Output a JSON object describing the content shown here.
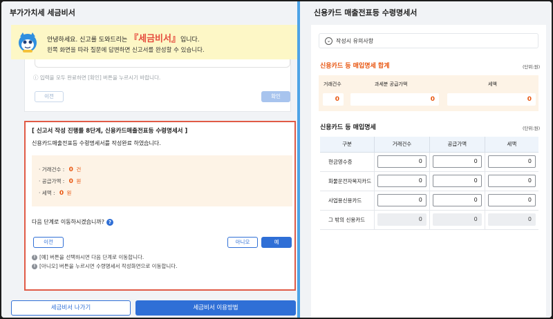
{
  "left": {
    "title": "부가가치세 세금비서",
    "banner": {
      "greeting_pre": "안녕하세요. 신고를 도와드리는",
      "brand": "『세금비서』",
      "greeting_post": "입니다.",
      "line2": "왼쪽 화면을 따라 질문에 답변하면 신고서를 완성할 수 있습니다."
    },
    "prev_step": {
      "note": "ⓘ 입력을 모두 완료하면 [확인] 버튼을 누르시기 바랍니다.",
      "back_label": "이전",
      "confirm_label": "확인"
    },
    "step": {
      "title": "[ 신고서 작성 진행률 8단계, 신용카드매출전표등 수령명세서 ]",
      "message": "신용카드매출전표등 수령명세서를 작성완료 하였습니다.",
      "summary": [
        {
          "label": "· 거래건수 :",
          "value": "0",
          "unit": "건"
        },
        {
          "label": "· 공급가액 :",
          "value": "0",
          "unit": "원"
        },
        {
          "label": "· 세액 :",
          "value": "0",
          "unit": "원"
        }
      ],
      "question": "다음 단계로 이동하시겠습니까?",
      "prev_label": "이전",
      "no_label": "아니오",
      "yes_label": "예",
      "notes": [
        "[예] 버튼을 선택하시면 다음 단계로 이동합니다.",
        "[아니오] 버튼을 누르시면 수령명세서 작성화면으로 이동합니다."
      ]
    },
    "bottom": {
      "exit_label": "세금비서 나가기",
      "guide_label": "세금비서 이용방법"
    }
  },
  "right": {
    "title": "신용카드 매출전표등 수령명세서",
    "notice_label": "작성시 유의사항",
    "total_section": {
      "title": "신용카드 등 매입명세 합계",
      "unit": "(단위:원)",
      "headers": [
        "거래건수",
        "과세분 공급가액",
        "세액"
      ],
      "values": [
        "0",
        "0",
        "0"
      ]
    },
    "detail_section": {
      "title": "신용카드 등 매입명세",
      "unit": "(단위:원)",
      "columns": [
        "구분",
        "거래건수",
        "공급가액",
        "세액"
      ],
      "rows": [
        {
          "label": "현금영수증",
          "values": [
            "0",
            "0",
            "0"
          ],
          "readonly": false
        },
        {
          "label": "화물운전자복지카드",
          "values": [
            "0",
            "0",
            "0"
          ],
          "readonly": false
        },
        {
          "label": "사업용신용카드",
          "values": [
            "0",
            "0",
            "0"
          ],
          "readonly": false
        },
        {
          "label": "그 밖의 신용카드",
          "values": [
            "0",
            "0",
            "0"
          ],
          "readonly": true
        }
      ]
    }
  },
  "colors": {
    "accent_blue": "#2f6fd6",
    "highlight_orange": "#e8550f",
    "banner_yellow": "#fdf7c6",
    "step_border_red": "#e05a45",
    "divider_blue": "#4da3e6"
  }
}
